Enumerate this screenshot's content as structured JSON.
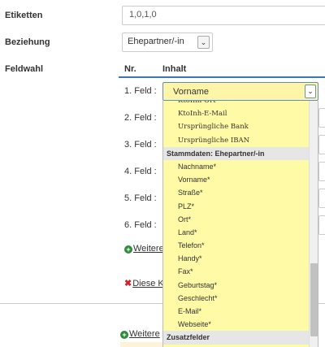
{
  "form": {
    "etiketten_label": "Etiketten",
    "etiketten_value": "1,0,1,0",
    "beziehung_label": "Beziehung",
    "beziehung_value": "Ehepartner/-in",
    "feldwahl_label": "Feldwahl"
  },
  "table": {
    "col_nr": "Nr.",
    "col_inhalt": "Inhalt",
    "rows": [
      {
        "label": "1. Feld :",
        "value": "Vorname"
      },
      {
        "label": "2. Feld :"
      },
      {
        "label": "3. Feld :"
      },
      {
        "label": "4. Feld :"
      },
      {
        "label": "5. Feld :"
      },
      {
        "label": "6. Feld :"
      }
    ]
  },
  "dropdown": {
    "items": [
      {
        "text": "KtoInh-Ort",
        "serif": true
      },
      {
        "text": "KtoInh-E-Mail",
        "serif": true
      },
      {
        "text": "Ursprüngliche Bank",
        "serif": true
      },
      {
        "text": "Ursprüngliche IBAN",
        "serif": true
      },
      {
        "text": "Stammdaten: Ehepartner/-in",
        "group": true
      },
      {
        "text": "Nachname*"
      },
      {
        "text": "Vorname*"
      },
      {
        "text": "Straße*"
      },
      {
        "text": "PLZ*"
      },
      {
        "text": "Ort*"
      },
      {
        "text": "Land*"
      },
      {
        "text": "Telefon*"
      },
      {
        "text": "Handy*"
      },
      {
        "text": "Fax*"
      },
      {
        "text": "Geburtstag*"
      },
      {
        "text": "Geschlecht*"
      },
      {
        "text": "E-Mail*"
      },
      {
        "text": "Webseite*"
      },
      {
        "text": "Zusatzfelder",
        "group": true
      }
    ]
  },
  "links": {
    "weitere_1": "Weitere",
    "diese_ke": "Diese Ke",
    "weitere_2": "Weitere"
  },
  "icons": {
    "arrow": "chevron-down-icon",
    "plus": "plus-circle-icon",
    "x": "delete-x-icon"
  },
  "colors": {
    "highlight": "#fff5a8",
    "dropdown_bg": "#fffaa5",
    "accent": "#3a78b5",
    "plus_green": "#2e8b3a",
    "delete_red": "#d2232a"
  }
}
